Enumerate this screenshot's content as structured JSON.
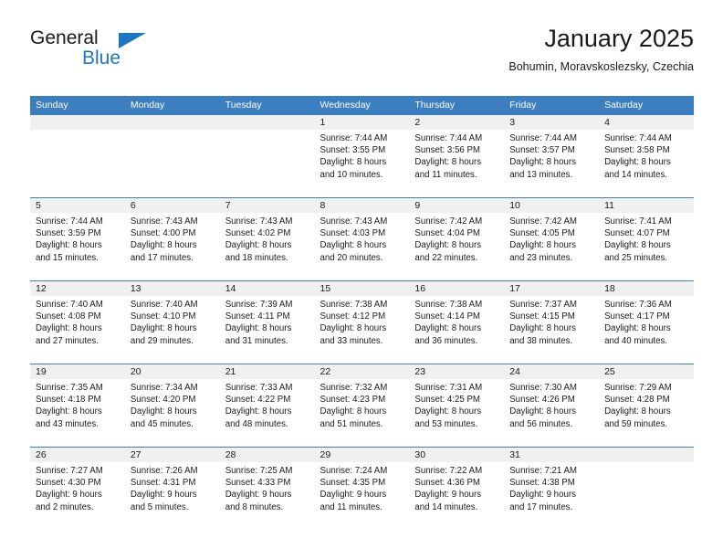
{
  "brand": {
    "name_top": "General",
    "name_bottom": "Blue",
    "accent_color": "#1c77c3"
  },
  "header": {
    "title": "January 2025",
    "subtitle": "Bohumin, Moravskoslezsky, Czechia"
  },
  "theme": {
    "header_row_bg": "#3c7fc1",
    "header_row_text": "#ffffff",
    "daynum_band_bg": "#f0f0f0",
    "grid_line": "#3c7fc1",
    "text": "#1a1a1a"
  },
  "weekday_headers": [
    "Sunday",
    "Monday",
    "Tuesday",
    "Wednesday",
    "Thursday",
    "Friday",
    "Saturday"
  ],
  "weeks": [
    [
      {
        "day": "",
        "empty": true,
        "sunrise": "",
        "sunset": "",
        "daylight_line1": "",
        "daylight_line2": ""
      },
      {
        "day": "",
        "empty": true,
        "sunrise": "",
        "sunset": "",
        "daylight_line1": "",
        "daylight_line2": ""
      },
      {
        "day": "",
        "empty": true,
        "sunrise": "",
        "sunset": "",
        "daylight_line1": "",
        "daylight_line2": ""
      },
      {
        "day": "1",
        "empty": false,
        "sunrise": "Sunrise: 7:44 AM",
        "sunset": "Sunset: 3:55 PM",
        "daylight_line1": "Daylight: 8 hours",
        "daylight_line2": "and 10 minutes."
      },
      {
        "day": "2",
        "empty": false,
        "sunrise": "Sunrise: 7:44 AM",
        "sunset": "Sunset: 3:56 PM",
        "daylight_line1": "Daylight: 8 hours",
        "daylight_line2": "and 11 minutes."
      },
      {
        "day": "3",
        "empty": false,
        "sunrise": "Sunrise: 7:44 AM",
        "sunset": "Sunset: 3:57 PM",
        "daylight_line1": "Daylight: 8 hours",
        "daylight_line2": "and 13 minutes."
      },
      {
        "day": "4",
        "empty": false,
        "sunrise": "Sunrise: 7:44 AM",
        "sunset": "Sunset: 3:58 PM",
        "daylight_line1": "Daylight: 8 hours",
        "daylight_line2": "and 14 minutes."
      }
    ],
    [
      {
        "day": "5",
        "empty": false,
        "sunrise": "Sunrise: 7:44 AM",
        "sunset": "Sunset: 3:59 PM",
        "daylight_line1": "Daylight: 8 hours",
        "daylight_line2": "and 15 minutes."
      },
      {
        "day": "6",
        "empty": false,
        "sunrise": "Sunrise: 7:43 AM",
        "sunset": "Sunset: 4:00 PM",
        "daylight_line1": "Daylight: 8 hours",
        "daylight_line2": "and 17 minutes."
      },
      {
        "day": "7",
        "empty": false,
        "sunrise": "Sunrise: 7:43 AM",
        "sunset": "Sunset: 4:02 PM",
        "daylight_line1": "Daylight: 8 hours",
        "daylight_line2": "and 18 minutes."
      },
      {
        "day": "8",
        "empty": false,
        "sunrise": "Sunrise: 7:43 AM",
        "sunset": "Sunset: 4:03 PM",
        "daylight_line1": "Daylight: 8 hours",
        "daylight_line2": "and 20 minutes."
      },
      {
        "day": "9",
        "empty": false,
        "sunrise": "Sunrise: 7:42 AM",
        "sunset": "Sunset: 4:04 PM",
        "daylight_line1": "Daylight: 8 hours",
        "daylight_line2": "and 22 minutes."
      },
      {
        "day": "10",
        "empty": false,
        "sunrise": "Sunrise: 7:42 AM",
        "sunset": "Sunset: 4:05 PM",
        "daylight_line1": "Daylight: 8 hours",
        "daylight_line2": "and 23 minutes."
      },
      {
        "day": "11",
        "empty": false,
        "sunrise": "Sunrise: 7:41 AM",
        "sunset": "Sunset: 4:07 PM",
        "daylight_line1": "Daylight: 8 hours",
        "daylight_line2": "and 25 minutes."
      }
    ],
    [
      {
        "day": "12",
        "empty": false,
        "sunrise": "Sunrise: 7:40 AM",
        "sunset": "Sunset: 4:08 PM",
        "daylight_line1": "Daylight: 8 hours",
        "daylight_line2": "and 27 minutes."
      },
      {
        "day": "13",
        "empty": false,
        "sunrise": "Sunrise: 7:40 AM",
        "sunset": "Sunset: 4:10 PM",
        "daylight_line1": "Daylight: 8 hours",
        "daylight_line2": "and 29 minutes."
      },
      {
        "day": "14",
        "empty": false,
        "sunrise": "Sunrise: 7:39 AM",
        "sunset": "Sunset: 4:11 PM",
        "daylight_line1": "Daylight: 8 hours",
        "daylight_line2": "and 31 minutes."
      },
      {
        "day": "15",
        "empty": false,
        "sunrise": "Sunrise: 7:38 AM",
        "sunset": "Sunset: 4:12 PM",
        "daylight_line1": "Daylight: 8 hours",
        "daylight_line2": "and 33 minutes."
      },
      {
        "day": "16",
        "empty": false,
        "sunrise": "Sunrise: 7:38 AM",
        "sunset": "Sunset: 4:14 PM",
        "daylight_line1": "Daylight: 8 hours",
        "daylight_line2": "and 36 minutes."
      },
      {
        "day": "17",
        "empty": false,
        "sunrise": "Sunrise: 7:37 AM",
        "sunset": "Sunset: 4:15 PM",
        "daylight_line1": "Daylight: 8 hours",
        "daylight_line2": "and 38 minutes."
      },
      {
        "day": "18",
        "empty": false,
        "sunrise": "Sunrise: 7:36 AM",
        "sunset": "Sunset: 4:17 PM",
        "daylight_line1": "Daylight: 8 hours",
        "daylight_line2": "and 40 minutes."
      }
    ],
    [
      {
        "day": "19",
        "empty": false,
        "sunrise": "Sunrise: 7:35 AM",
        "sunset": "Sunset: 4:18 PM",
        "daylight_line1": "Daylight: 8 hours",
        "daylight_line2": "and 43 minutes."
      },
      {
        "day": "20",
        "empty": false,
        "sunrise": "Sunrise: 7:34 AM",
        "sunset": "Sunset: 4:20 PM",
        "daylight_line1": "Daylight: 8 hours",
        "daylight_line2": "and 45 minutes."
      },
      {
        "day": "21",
        "empty": false,
        "sunrise": "Sunrise: 7:33 AM",
        "sunset": "Sunset: 4:22 PM",
        "daylight_line1": "Daylight: 8 hours",
        "daylight_line2": "and 48 minutes."
      },
      {
        "day": "22",
        "empty": false,
        "sunrise": "Sunrise: 7:32 AM",
        "sunset": "Sunset: 4:23 PM",
        "daylight_line1": "Daylight: 8 hours",
        "daylight_line2": "and 51 minutes."
      },
      {
        "day": "23",
        "empty": false,
        "sunrise": "Sunrise: 7:31 AM",
        "sunset": "Sunset: 4:25 PM",
        "daylight_line1": "Daylight: 8 hours",
        "daylight_line2": "and 53 minutes."
      },
      {
        "day": "24",
        "empty": false,
        "sunrise": "Sunrise: 7:30 AM",
        "sunset": "Sunset: 4:26 PM",
        "daylight_line1": "Daylight: 8 hours",
        "daylight_line2": "and 56 minutes."
      },
      {
        "day": "25",
        "empty": false,
        "sunrise": "Sunrise: 7:29 AM",
        "sunset": "Sunset: 4:28 PM",
        "daylight_line1": "Daylight: 8 hours",
        "daylight_line2": "and 59 minutes."
      }
    ],
    [
      {
        "day": "26",
        "empty": false,
        "sunrise": "Sunrise: 7:27 AM",
        "sunset": "Sunset: 4:30 PM",
        "daylight_line1": "Daylight: 9 hours",
        "daylight_line2": "and 2 minutes."
      },
      {
        "day": "27",
        "empty": false,
        "sunrise": "Sunrise: 7:26 AM",
        "sunset": "Sunset: 4:31 PM",
        "daylight_line1": "Daylight: 9 hours",
        "daylight_line2": "and 5 minutes."
      },
      {
        "day": "28",
        "empty": false,
        "sunrise": "Sunrise: 7:25 AM",
        "sunset": "Sunset: 4:33 PM",
        "daylight_line1": "Daylight: 9 hours",
        "daylight_line2": "and 8 minutes."
      },
      {
        "day": "29",
        "empty": false,
        "sunrise": "Sunrise: 7:24 AM",
        "sunset": "Sunset: 4:35 PM",
        "daylight_line1": "Daylight: 9 hours",
        "daylight_line2": "and 11 minutes."
      },
      {
        "day": "30",
        "empty": false,
        "sunrise": "Sunrise: 7:22 AM",
        "sunset": "Sunset: 4:36 PM",
        "daylight_line1": "Daylight: 9 hours",
        "daylight_line2": "and 14 minutes."
      },
      {
        "day": "31",
        "empty": false,
        "sunrise": "Sunrise: 7:21 AM",
        "sunset": "Sunset: 4:38 PM",
        "daylight_line1": "Daylight: 9 hours",
        "daylight_line2": "and 17 minutes."
      },
      {
        "day": "",
        "empty": true,
        "sunrise": "",
        "sunset": "",
        "daylight_line1": "",
        "daylight_line2": ""
      }
    ]
  ]
}
